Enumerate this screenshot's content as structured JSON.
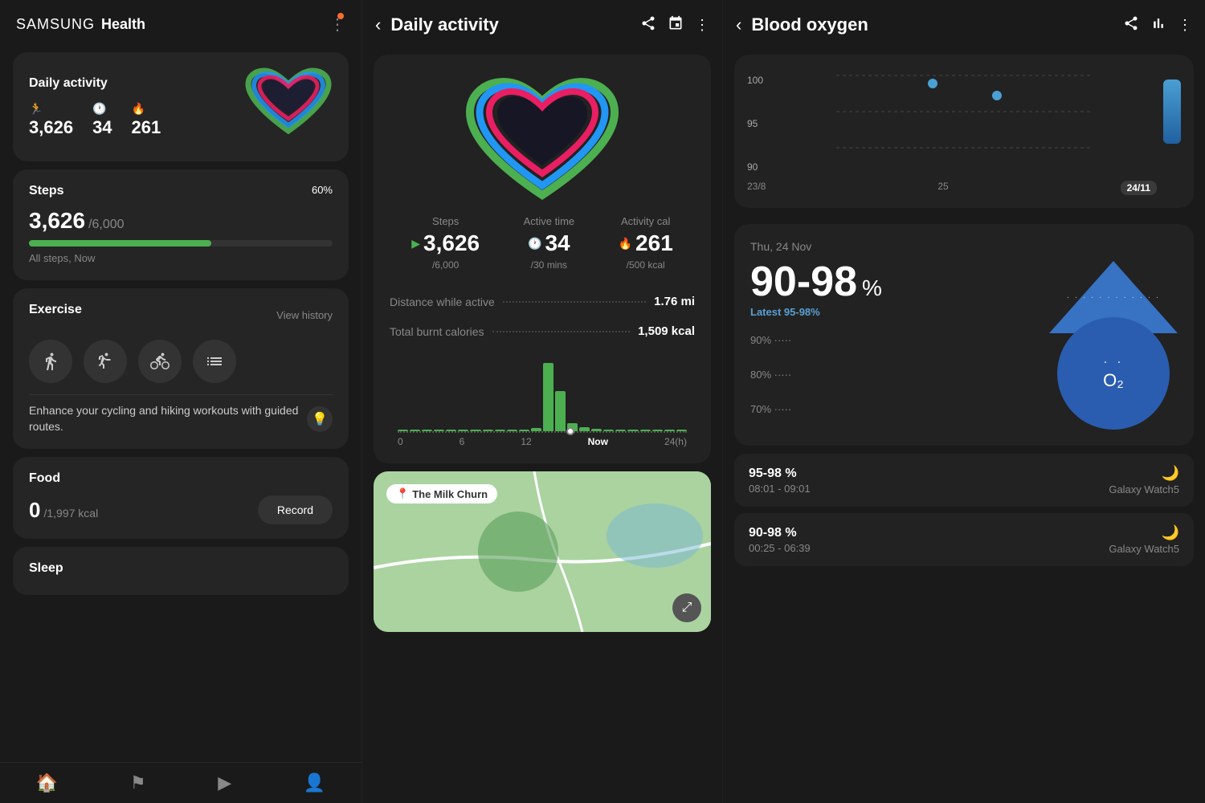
{
  "left": {
    "header": {
      "brand": "SAMSUNG",
      "app": "Health",
      "more_icon": "⋮"
    },
    "daily_activity": {
      "title": "Daily activity",
      "steps_value": "3,626",
      "active_time_value": "34",
      "cal_value": "261"
    },
    "steps": {
      "title": "Steps",
      "value": "3,626",
      "goal": "/6,000",
      "percent": "60%",
      "sub": "All steps, Now",
      "fill_width": "60%"
    },
    "exercise": {
      "title": "Exercise",
      "view_history": "View history",
      "promo_text": "Enhance your cycling and hiking workouts with guided routes."
    },
    "food": {
      "title": "Food",
      "value": "0",
      "goal": "/1,997 kcal",
      "record_label": "Record"
    },
    "sleep": {
      "title": "Sleep"
    },
    "nav": {
      "home_icon": "🏠",
      "flag_icon": "🚩",
      "play_icon": "▶",
      "profile_icon": "👤"
    }
  },
  "middle": {
    "header": {
      "back_icon": "‹",
      "title": "Daily activity",
      "share_icon": "share",
      "calendar_icon": "cal",
      "more_icon": "⋮"
    },
    "heart": {
      "rings_colors": [
        "#4caf50",
        "#2196f3",
        "#e91e63"
      ]
    },
    "stats": {
      "steps_label": "Steps",
      "steps_value": "3,626",
      "steps_goal": "/6,000",
      "active_label": "Active time",
      "active_value": "34",
      "active_goal": "/30 mins",
      "cal_label": "Activity cal",
      "cal_value": "261",
      "cal_goal": "/500 kcal"
    },
    "metrics": {
      "distance_label": "Distance while active",
      "distance_value": "1.76 mi",
      "calories_label": "Total burnt calories",
      "calories_value": "1,509 kcal"
    },
    "chart": {
      "bars": [
        0,
        0,
        0,
        0,
        0,
        0,
        0,
        0,
        0,
        0,
        0,
        0,
        100,
        60,
        10,
        5,
        3,
        2,
        2,
        2,
        2,
        2,
        2,
        2
      ],
      "x_labels": [
        "0",
        "6",
        "12",
        "Now",
        "24(h)"
      ]
    },
    "map": {
      "location_label": "The Milk Churn",
      "expand_icon": "⤢"
    }
  },
  "right": {
    "header": {
      "back_icon": "‹",
      "title": "Blood oxygen",
      "share_icon": "share",
      "chart_icon": "chart",
      "more_icon": "⋮"
    },
    "chart": {
      "y_labels": [
        "100",
        "95",
        "90"
      ],
      "x_labels": [
        "23/8",
        "25",
        "24/11"
      ],
      "active_x": "24/11"
    },
    "reading": {
      "date": "Thu, 24 Nov",
      "value": "90-98",
      "unit": "%",
      "latest_label": "Latest 95-98%",
      "y_labels": [
        "90%",
        "80%",
        "70%"
      ]
    },
    "history": [
      {
        "range": "95-98 %",
        "time": "08:01 - 09:01",
        "icon": "🌙",
        "source": "Galaxy Watch5"
      },
      {
        "range": "90-98 %",
        "time": "00:25 - 06:39",
        "icon": "🌙",
        "source": "Galaxy Watch5"
      }
    ]
  }
}
